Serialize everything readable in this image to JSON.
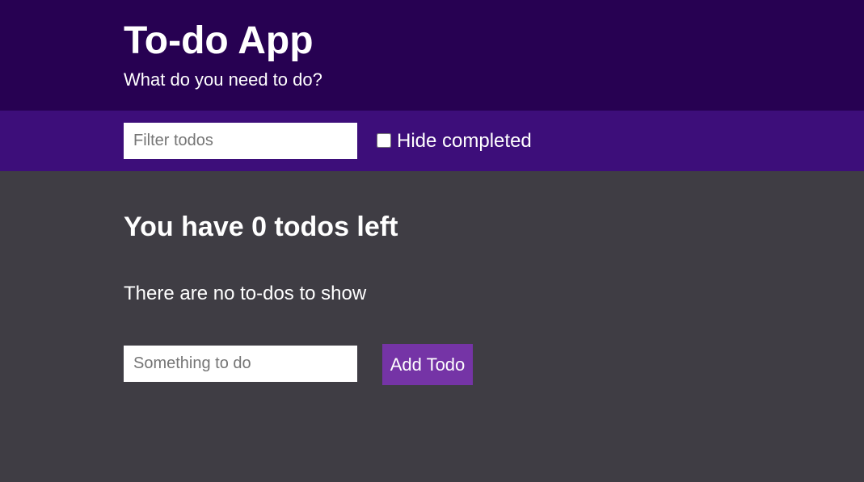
{
  "header": {
    "title": "To-do App",
    "subtitle": "What do you need to do?"
  },
  "filter_bar": {
    "filter_placeholder": "Filter todos",
    "filter_value": "",
    "hide_completed_label": "Hide completed",
    "hide_completed_checked": false
  },
  "main": {
    "todos_left_text": "You have 0 todos left",
    "empty_message": "There are no to-dos to show",
    "new_todo_placeholder": "Something to do",
    "new_todo_value": "",
    "add_button_label": "Add Todo"
  },
  "colors": {
    "header_bg": "#270152",
    "filter_bar_bg": "#3d0e7a",
    "main_bg": "#3f3d44",
    "button_bg": "#7534a6",
    "text": "#ffffff"
  }
}
